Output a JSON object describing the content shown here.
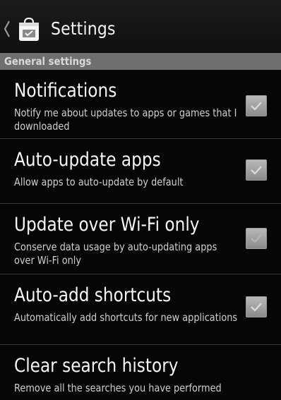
{
  "action_bar": {
    "title": "Settings",
    "back_icon": "chevron-left-icon",
    "app_icon": "market-bag-icon"
  },
  "section": {
    "label": "General settings"
  },
  "preferences": [
    {
      "title": "Notifications",
      "summary": "Notify me about updates to apps or games that I downloaded",
      "checked": true
    },
    {
      "title": "Auto-update apps",
      "summary": "Allow apps to auto-update by default",
      "checked": true
    },
    {
      "title": "Update over Wi-Fi only",
      "summary": "Conserve data usage by auto-updating apps over Wi-Fi only",
      "checked": true
    },
    {
      "title": "Auto-add shortcuts",
      "summary": "Automatically add shortcuts for new applications",
      "checked": true
    },
    {
      "title": "Clear search history",
      "summary": "Remove all the searches you have performed"
    }
  ],
  "colors": {
    "background": "#060606",
    "section_header": "#6f6f6f",
    "checkbox": "#a5a5a5"
  }
}
